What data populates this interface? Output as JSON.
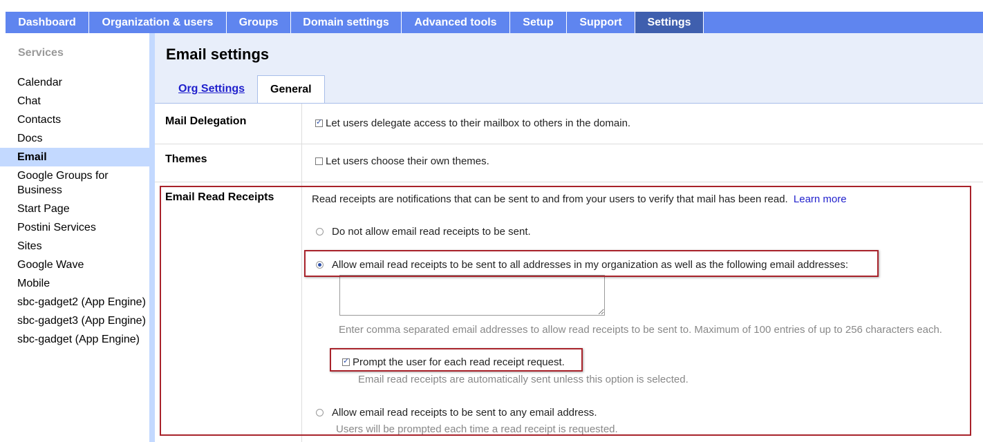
{
  "topnav": {
    "tabs": [
      "Dashboard",
      "Organization & users",
      "Groups",
      "Domain settings",
      "Advanced tools",
      "Setup",
      "Support",
      "Settings"
    ],
    "active": "Settings"
  },
  "sidebar": {
    "title": "Services",
    "items": [
      {
        "label": "Calendar"
      },
      {
        "label": "Chat"
      },
      {
        "label": "Contacts"
      },
      {
        "label": "Docs"
      },
      {
        "label": "Email",
        "active": true
      },
      {
        "label": "Google Groups for",
        "label2": "Business"
      },
      {
        "label": "Start Page"
      },
      {
        "label": "Postini Services"
      },
      {
        "label": "Sites"
      },
      {
        "label": "Google Wave"
      },
      {
        "label": "Mobile"
      },
      {
        "label": "sbc-gadget2 (App Engine)"
      },
      {
        "label": "sbc-gadget3 (App Engine)"
      },
      {
        "label": "sbc-gadget (App Engine)"
      }
    ]
  },
  "header": {
    "title": "Email settings",
    "tabs": [
      {
        "label": "Org Settings",
        "type": "link"
      },
      {
        "label": "General",
        "type": "active"
      }
    ]
  },
  "settings": {
    "mail_delegation": {
      "label": "Mail Delegation",
      "option": "Let users delegate access to their mailbox to others in the domain.",
      "checked": true
    },
    "themes": {
      "label": "Themes",
      "option": "Let users choose their own themes.",
      "checked": false
    },
    "read_receipts": {
      "label": "Email Read Receipts",
      "description": "Read receipts are notifications that can be sent to and from your users to verify that mail has been read.",
      "learn_more": "Learn more",
      "option_none": "Do not allow email read receipts to be sent.",
      "option_org": "Allow email read receipts to be sent to all addresses in my organization as well as the following email addresses:",
      "addresses_value": "",
      "addresses_help": "Enter comma separated email addresses to allow read receipts to be sent to. Maximum of 100 entries of up to 256 characters each.",
      "prompt_label": "Prompt the user for each read receipt request.",
      "prompt_checked": true,
      "prompt_help": "Email read receipts are automatically sent unless this option is selected.",
      "option_any": "Allow email read receipts to be sent to any email address.",
      "option_any_help": "Users will be prompted each time a read receipt is requested.",
      "selected": "org"
    }
  },
  "colors": {
    "nav_bg": "#5f85ef",
    "nav_active": "#3f5fae",
    "sidebar_active": "#c3d9ff",
    "header_bg": "#e8eefa",
    "highlight_border": "#a8222a",
    "link": "#1f1fcc"
  }
}
